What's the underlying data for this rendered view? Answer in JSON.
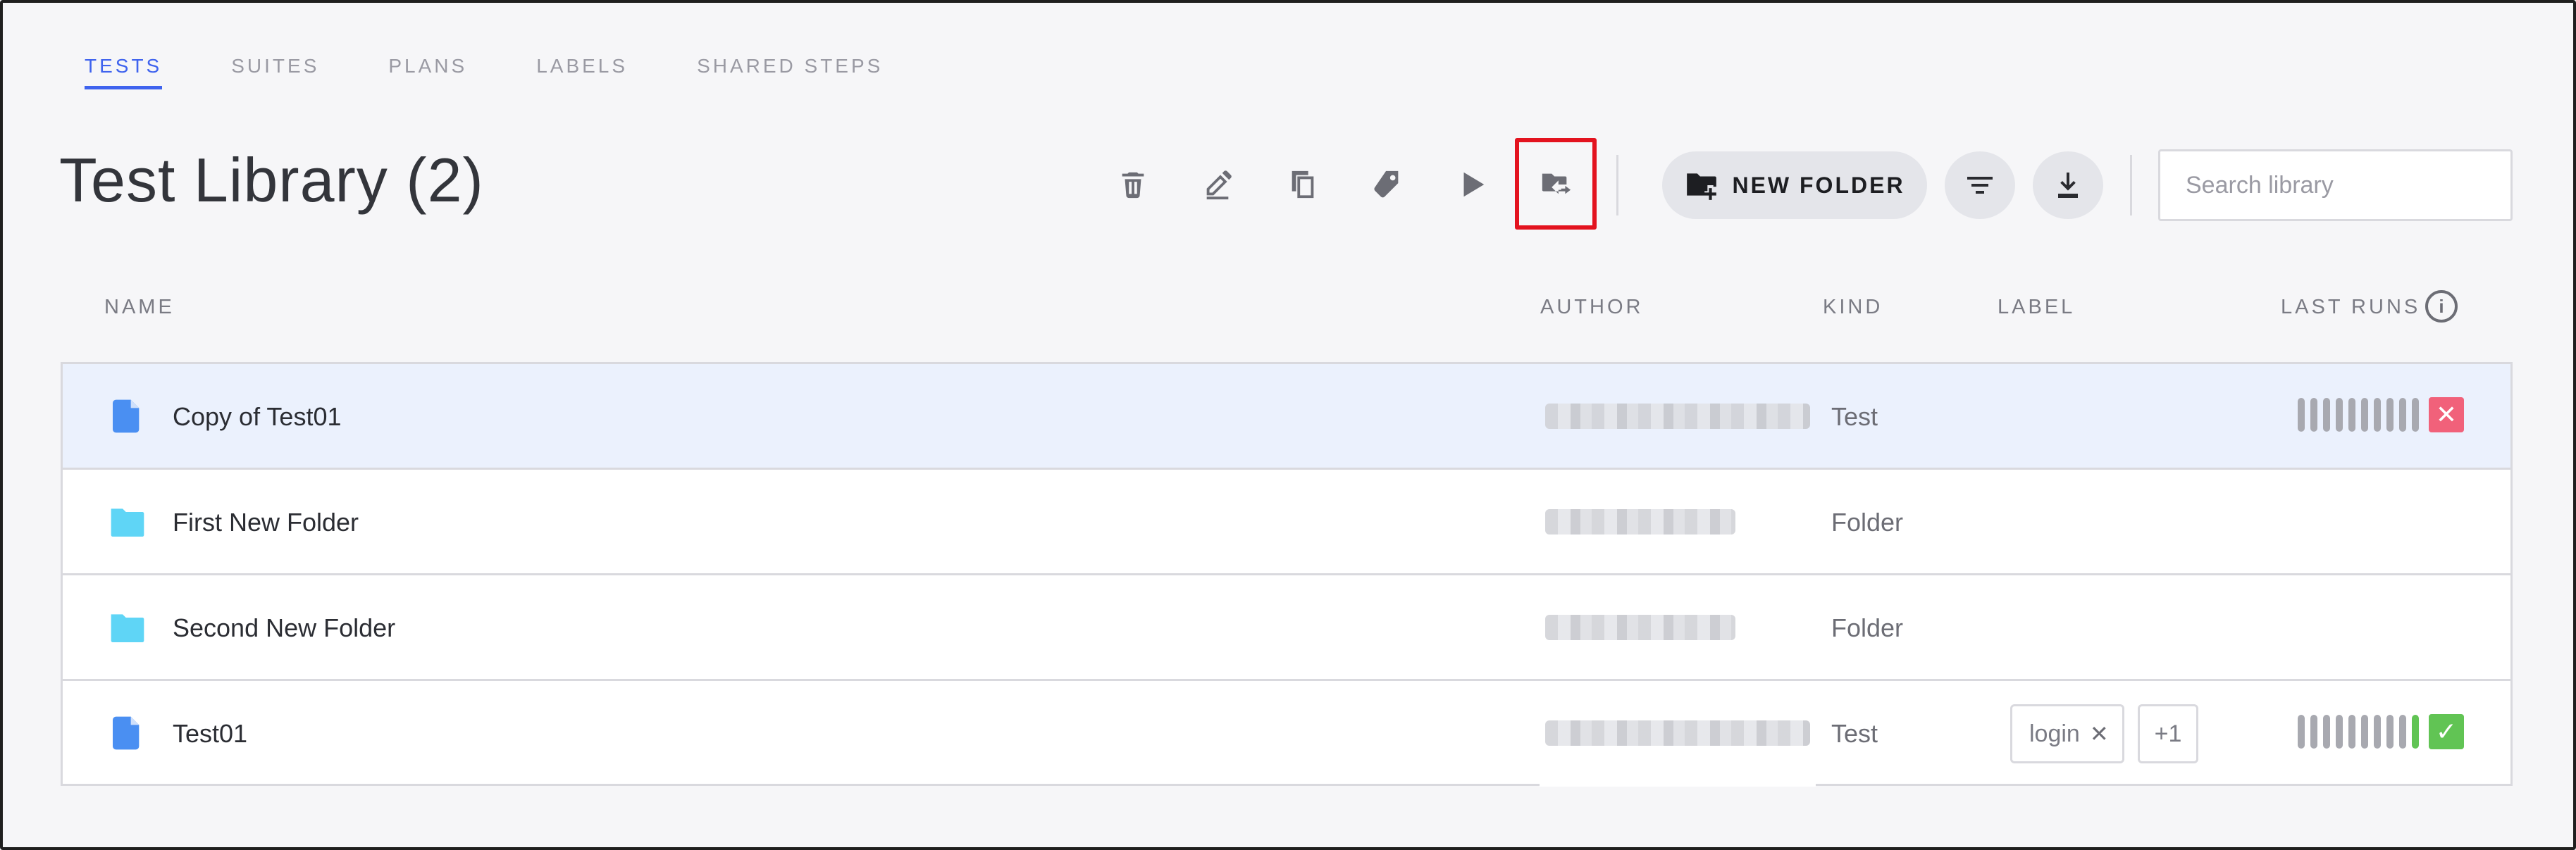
{
  "tabs": [
    {
      "label": "TESTS",
      "active": true
    },
    {
      "label": "SUITES",
      "active": false
    },
    {
      "label": "PLANS",
      "active": false
    },
    {
      "label": "LABELS",
      "active": false
    },
    {
      "label": "SHARED STEPS",
      "active": false
    }
  ],
  "header": {
    "title": "Test Library (2)",
    "new_folder_label": "NEW FOLDER",
    "search_placeholder": "Search library"
  },
  "toolbar_icons": [
    "trash-icon",
    "edit-icon",
    "copy-icon",
    "tag-icon",
    "play-icon",
    "move-to-folder-icon",
    "filter-icon",
    "download-icon"
  ],
  "columns": {
    "name": "NAME",
    "author": "AUTHOR",
    "kind": "KIND",
    "label": "LABEL",
    "last_runs": "LAST RUNS"
  },
  "rows": [
    {
      "name": "Copy of Test01",
      "kind": "Test",
      "icon": "file-icon",
      "selected": true,
      "last_run_status": "failed"
    },
    {
      "name": "First New Folder",
      "kind": "Folder",
      "icon": "folder-icon"
    },
    {
      "name": "Second New Folder",
      "kind": "Folder",
      "icon": "folder-icon"
    },
    {
      "name": "Test01",
      "kind": "Test",
      "icon": "file-icon",
      "label": "login",
      "label_more": "+1",
      "last_run_status": "passed"
    }
  ],
  "colors": {
    "accent": "#3f63ee",
    "highlight": "#e3131f",
    "file_icon": "#4a8ff2",
    "folder_icon": "#5fd5f6",
    "pass": "#61c454",
    "fail": "#f1617a"
  }
}
